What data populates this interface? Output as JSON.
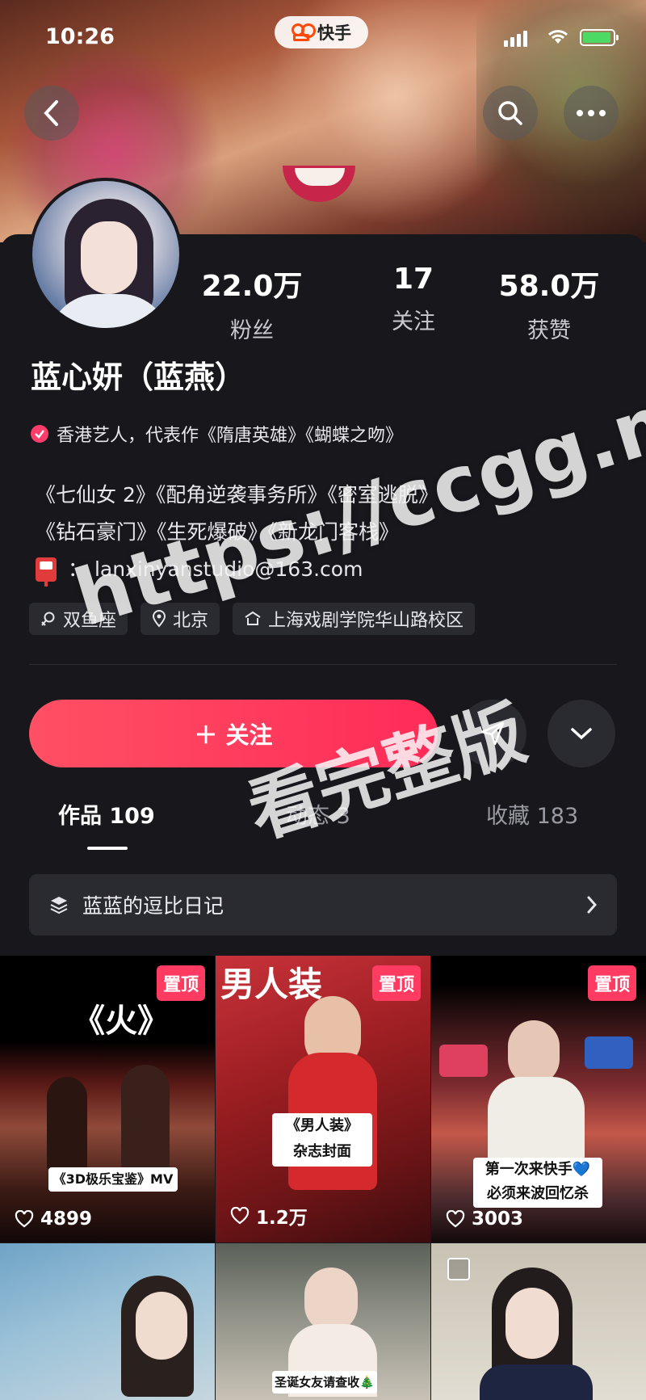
{
  "status_bar": {
    "time": "10:26",
    "app_name": "快手"
  },
  "profile": {
    "name": "蓝心妍（蓝燕）",
    "verified_text": "香港艺人，代表作《隋唐英雄》《蝴蝶之吻》",
    "bio_line1": "《七仙女 2》《配角逆袭事务所》《密室逃脱》",
    "bio_line2": "《钻石豪门》《生死爆破》《新龙门客栈》",
    "email": "：  lanxinyanstudio@163.com",
    "tags": [
      {
        "icon": "zodiac-icon",
        "label": "双鱼座"
      },
      {
        "icon": "location-icon",
        "label": "北京"
      },
      {
        "icon": "school-icon",
        "label": "上海戏剧学院华山路校区"
      }
    ]
  },
  "stats": [
    {
      "value": "22.0万",
      "label": "粉丝"
    },
    {
      "value": "17",
      "label": "关注"
    },
    {
      "value": "58.0万",
      "label": "获赞"
    }
  ],
  "actions": {
    "follow_label": "＋ 关注"
  },
  "tabs": [
    {
      "label": "作品 109",
      "active": true
    },
    {
      "label": "动态 3",
      "active": false
    },
    {
      "label": "收藏 183",
      "active": false
    }
  ],
  "collection": {
    "label": "蓝蓝的逗比日记"
  },
  "videos": [
    {
      "pinned": "置顶",
      "likes": "4899",
      "title": "《火》",
      "caption": "《3D极乐宝鉴》MV"
    },
    {
      "pinned": "置顶",
      "likes": "1.2万",
      "title": "男人装",
      "caption": "《男人装》\n杂志封面"
    },
    {
      "pinned": "置顶",
      "likes": "3003",
      "caption": "第一次来快手💙\n必须来波回忆杀"
    },
    {
      "caption": ""
    },
    {
      "caption": "圣诞女友请查收🎄"
    },
    {
      "caption": ""
    }
  ],
  "watermark": {
    "line1": "https://ccgg.me",
    "line2": "看完整版"
  },
  "colors": {
    "accent": "#ff2b58",
    "pin": "#ff3b62",
    "background": "#17171c",
    "chip": "#2a2a31"
  }
}
